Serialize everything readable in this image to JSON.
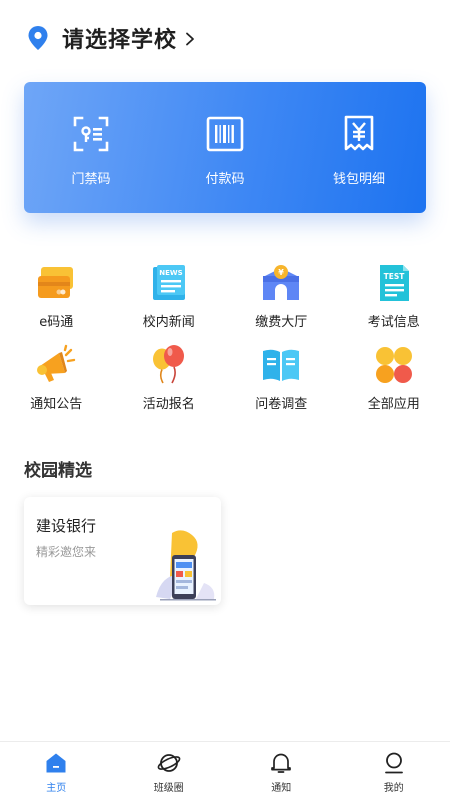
{
  "header": {
    "school_title": "请选择学校"
  },
  "card": {
    "items": [
      {
        "label": "门禁码",
        "icon": "access-code-icon"
      },
      {
        "label": "付款码",
        "icon": "barcode-icon"
      },
      {
        "label": "钱包明细",
        "icon": "wallet-detail-icon"
      }
    ]
  },
  "grid": {
    "items": [
      {
        "label": "e码通",
        "icon": "card-icon"
      },
      {
        "label": "校内新闻",
        "icon": "news-icon"
      },
      {
        "label": "缴费大厅",
        "icon": "payment-hall-icon"
      },
      {
        "label": "考试信息",
        "icon": "test-icon"
      },
      {
        "label": "通知公告",
        "icon": "megaphone-icon"
      },
      {
        "label": "活动报名",
        "icon": "balloon-icon"
      },
      {
        "label": "问卷调查",
        "icon": "book-icon"
      },
      {
        "label": "全部应用",
        "icon": "all-apps-icon"
      }
    ]
  },
  "section": {
    "title": "校园精选",
    "promo": {
      "title": "建设银行",
      "subtitle": "精彩邀您来"
    }
  },
  "nav": {
    "items": [
      {
        "label": "主页",
        "icon": "home-icon",
        "active": true
      },
      {
        "label": "班级圈",
        "icon": "planet-icon",
        "active": false
      },
      {
        "label": "通知",
        "icon": "bell-icon",
        "active": false
      },
      {
        "label": "我的",
        "icon": "user-icon",
        "active": false
      }
    ]
  },
  "colors": {
    "accent": "#2f80ed",
    "card_start": "#6fa6f7",
    "card_end": "#1d73f0"
  }
}
